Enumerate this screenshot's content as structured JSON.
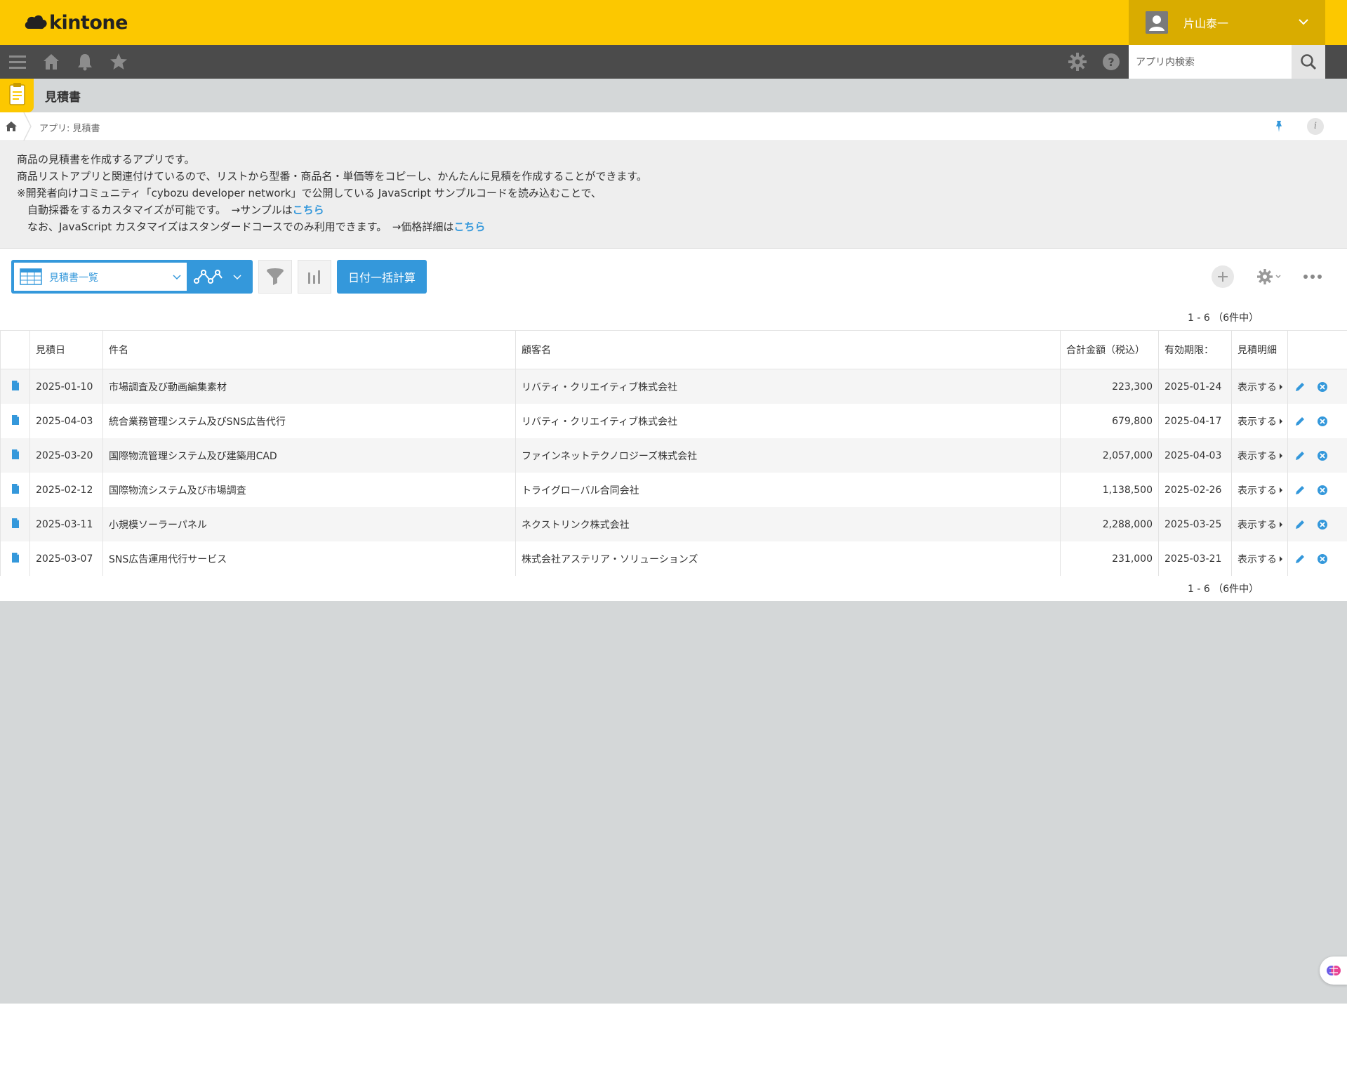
{
  "header": {
    "logo_text": "kintone",
    "user_name": "片山泰一",
    "brand_color": "#fcc800"
  },
  "gnav": {
    "search_placeholder": "アプリ内検索"
  },
  "app": {
    "title": "見積書",
    "breadcrumb": "アプリ: 見積書"
  },
  "description": {
    "line1": "商品の見積書を作成するアプリです。",
    "line2": "商品リストアプリと関連付けているので、リストから型番・商品名・単価等をコピーし、かんたんに見積を作成することができます。",
    "line3": "※開発者向けコミュニティ「cybozu developer network」で公開している JavaScript サンプルコードを読み込むことで、",
    "line4_text": "　自動採番をするカスタマイズが可能です。　→サンプルは",
    "line4_link": "こちら",
    "line5_text": "　なお、JavaScript カスタマイズはスタンダードコースでのみ利用できます。　→価格詳細は",
    "line5_link": "こちら"
  },
  "toolbar": {
    "view_name": "見積書一覧",
    "calc_button": "日付一括計算",
    "accent_color": "#3498db"
  },
  "pager": {
    "top": "1 - 6 （6件中）",
    "bottom": "1 - 6 （6件中）"
  },
  "table": {
    "columns": [
      "見積日",
      "件名",
      "顧客名",
      "合計金額（税込）",
      "有効期限：",
      "見積明細"
    ],
    "show_label": "表示する",
    "rows": [
      {
        "date": "2025-01-10",
        "subject": "市場調査及び動画編集素材",
        "customer": "リバティ・クリエイティブ株式会社",
        "total": "223,300",
        "expiry": "2025-01-24"
      },
      {
        "date": "2025-04-03",
        "subject": "統合業務管理システム及びSNS広告代行",
        "customer": "リバティ・クリエイティブ株式会社",
        "total": "679,800",
        "expiry": "2025-04-17"
      },
      {
        "date": "2025-03-20",
        "subject": "国際物流管理システム及び建築用CAD",
        "customer": "ファインネットテクノロジーズ株式会社",
        "total": "2,057,000",
        "expiry": "2025-04-03"
      },
      {
        "date": "2025-02-12",
        "subject": "国際物流システム及び市場調査",
        "customer": "トライグローバル合同会社",
        "total": "1,138,500",
        "expiry": "2025-02-26"
      },
      {
        "date": "2025-03-11",
        "subject": "小規模ソーラーパネル",
        "customer": "ネクストリンク株式会社",
        "total": "2,288,000",
        "expiry": "2025-03-25"
      },
      {
        "date": "2025-03-07",
        "subject": "SNS広告運用代行サービス",
        "customer": "株式会社アステリア・ソリューションズ",
        "total": "231,000",
        "expiry": "2025-03-21"
      }
    ]
  }
}
